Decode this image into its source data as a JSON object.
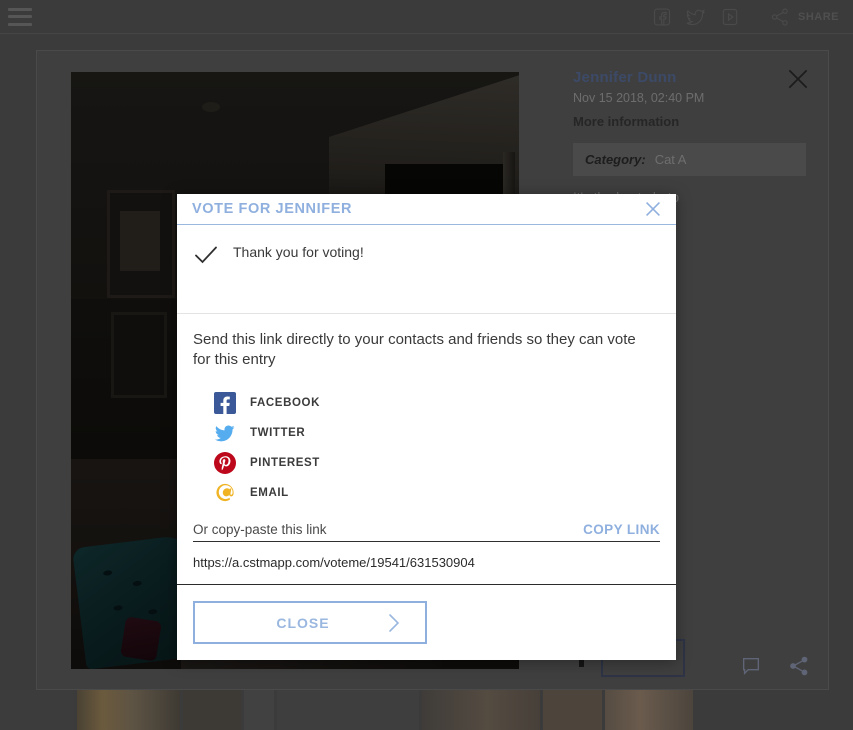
{
  "topbar": {
    "menu_icon": "hamburger-menu-icon",
    "social": [
      {
        "icon": "facebook-icon",
        "name": "Facebook"
      },
      {
        "icon": "twitter-icon",
        "name": "Twitter"
      },
      {
        "icon": "video-icon",
        "name": "Video"
      }
    ],
    "share_icon": "share-nodes-icon",
    "share_label": "SHARE"
  },
  "lightbox": {
    "entrant_name": "Jennifer Dunn",
    "date": "Nov 15 2018, 02:40 PM",
    "more_information": "More information",
    "category_label": "Category:",
    "category_value": "Cat A",
    "description": "It's the best photo",
    "close_icon": "close-icon",
    "comment_icon": "comment-icon",
    "share_icon": "share-nodes-icon"
  },
  "modal": {
    "title": "VOTE FOR JENNIFER",
    "close_icon": "close-icon",
    "check_icon": "checkmark-icon",
    "thanks_message": "Thank you for voting!",
    "share_lead": "Send this link directly to your contacts and friends so they can vote for this entry",
    "share_options": [
      {
        "icon": "facebook-icon",
        "label": "FACEBOOK",
        "color": "#3B5998"
      },
      {
        "icon": "twitter-icon",
        "label": "TWITTER",
        "color": "#55ACEE"
      },
      {
        "icon": "pinterest-icon",
        "label": "PINTEREST",
        "color": "#BD081C"
      },
      {
        "icon": "email-icon",
        "label": "EMAIL",
        "color": "#F0B323"
      }
    ],
    "copy_hint": "Or copy-paste this link",
    "copy_link_label": "COPY LINK",
    "copy_url": "https://a.cstmapp.com/voteme/19541/631530904",
    "close_button_label": "CLOSE",
    "chevron_icon": "chevron-right-icon"
  },
  "colors": {
    "accent_blue": "#8fb0df",
    "page_bg": "#3b3b3b",
    "modal_bg": "#ffffff",
    "name_blue": "#3c4a68"
  }
}
